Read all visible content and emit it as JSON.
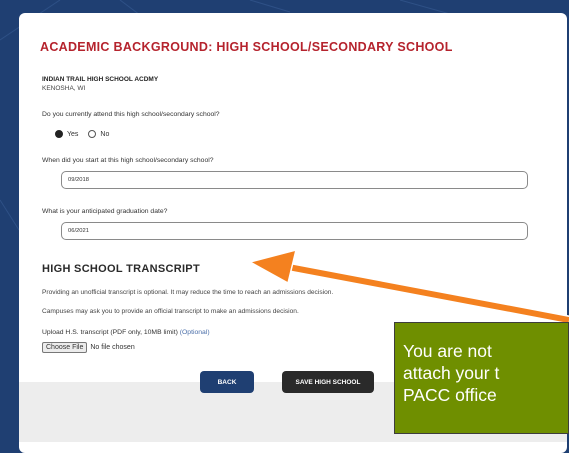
{
  "modal": {
    "section_title": "ACADEMIC BACKGROUND: HIGH SCHOOL/SECONDARY SCHOOL",
    "school_name": "INDIAN TRAIL HIGH SCHOOL ACDMY",
    "school_location": "KENOSHA, WI",
    "attend_question": "Do you currently attend this high school/secondary school?",
    "attend_options": [
      "Yes",
      "No"
    ],
    "attend_selected": "Yes",
    "start_question": "When did you start at this high school/secondary school?",
    "start_value": "09/2018",
    "grad_question": "What is your anticipated graduation date?",
    "grad_value": "06/2021",
    "transcript_title": "HIGH SCHOOL TRANSCRIPT",
    "transcript_para1": "Providing an unofficial transcript is optional. It may reduce the time to reach an admissions decision.",
    "transcript_para2": "Campuses may ask you to provide an official transcript to make an admissions decision.",
    "upload_label": "Upload H.S. transcript (PDF only, 10MB limit)",
    "upload_optional": "(Optional)",
    "choose_file_label": "Choose File",
    "no_file_text": "No file chosen"
  },
  "footer": {
    "back_label": "BACK",
    "save_label": "SAVE HIGH SCHOOL"
  },
  "callout": {
    "line1": "You are not",
    "line2": "attach your t",
    "line3": "PACC office"
  },
  "colors": {
    "background": "#1f3f72",
    "title_red": "#b5232d",
    "arrow_orange": "#f4811f",
    "callout_green": "#6f8f00"
  }
}
